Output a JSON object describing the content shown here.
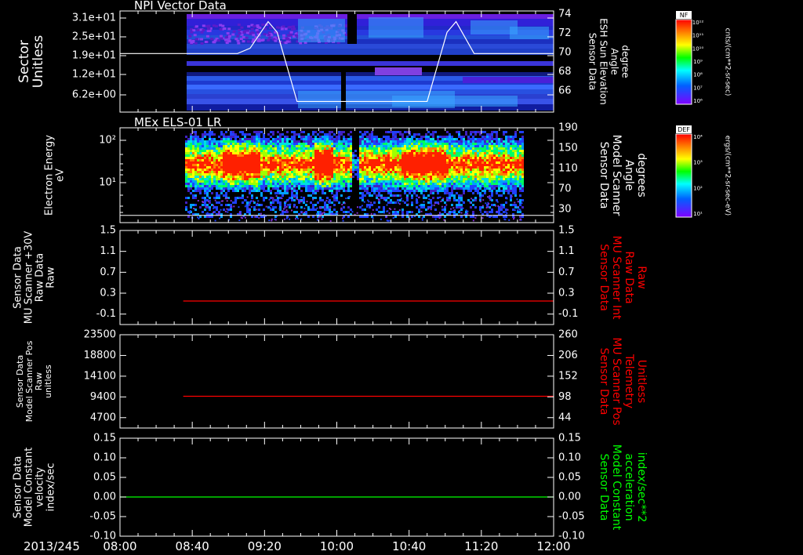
{
  "time_axis": {
    "labels": [
      "08:00",
      "08:40",
      "09:20",
      "10:00",
      "10:40",
      "11:20",
      "12:00"
    ],
    "date_label": "2013/245",
    "start": "08:00",
    "end": "12:00"
  },
  "colorbars": [
    {
      "label": "NF",
      "unit": "cnts/(cm**2-sr-sec)",
      "ticks": [
        "10¹²",
        "10¹¹",
        "10¹⁰",
        "10⁹",
        "10⁸",
        "10⁷",
        "10⁶"
      ]
    },
    {
      "label": "DEF",
      "unit": "ergs/(cm**2-sr-sec-eV)",
      "ticks": [
        "10⁴",
        "10³",
        "10²",
        "10¹"
      ]
    }
  ],
  "chart_data": [
    {
      "type": "heatmap",
      "title": "NPI Vector Data",
      "ylabel": [
        "Sector",
        "Unitless"
      ],
      "yticks": [
        "3.1e+01",
        "2.5e+01",
        "1.9e+01",
        "1.2e+01",
        "6.2e+00"
      ],
      "right_label": [
        "Sensor Data",
        "ESH Sun Elevation",
        "Angle",
        "degree"
      ],
      "right_label_color": "#ffffff",
      "right_ticks": [
        74,
        72,
        70,
        68,
        66
      ],
      "right_range": [
        64.5,
        74
      ],
      "line": {
        "color": "#ffffff",
        "x": [
          "08:00",
          "09:05",
          "09:12",
          "09:22",
          "09:27",
          "09:38",
          "10:50",
          "11:01",
          "11:06",
          "11:16",
          "12:00"
        ],
        "y": [
          70,
          70,
          70.5,
          73,
          72,
          65.5,
          65.5,
          72,
          73,
          70,
          70
        ]
      }
    },
    {
      "type": "heatmap",
      "title": "MEx ELS-01 LR",
      "ylabel": [
        "Electron Energy",
        "eV"
      ],
      "yticks": [
        "10²",
        "10¹"
      ],
      "right_label": [
        "Sensor Data",
        "Model Scanner",
        "Angle",
        "degrees"
      ],
      "right_label_color": "#ffffff",
      "right_ticks": [
        190,
        150,
        110,
        70,
        30
      ],
      "right_range": [
        0,
        190
      ],
      "line": {
        "color": "#ffffff",
        "x": [
          "08:00",
          "12:00"
        ],
        "y": [
          2,
          2
        ]
      }
    },
    {
      "type": "line",
      "ylabel": [
        "Sensor Data",
        "MU Scanner +30V",
        "Raw Data",
        "Raw"
      ],
      "yticks": [
        "1.5",
        "1.1",
        "0.7",
        "0.3",
        "-0.1"
      ],
      "yrange": [
        -0.5,
        1.5
      ],
      "right_label": [
        "Sensor Data",
        "MU Scanner Int",
        "Raw Data",
        "Raw"
      ],
      "right_label_color": "#ff0000",
      "right_ticks": [
        "1.5",
        "1.1",
        "0.7",
        "0.3",
        "-0.1"
      ],
      "series": [
        {
          "color": "#ff0000",
          "x": [
            "08:35",
            "12:00"
          ],
          "y": [
            0.0,
            0.0
          ]
        }
      ]
    },
    {
      "type": "line",
      "ylabel": [
        "Sensor Data",
        "Model Scanner Pos",
        "Raw",
        "unitless"
      ],
      "yticks": [
        "23500",
        "18800",
        "14100",
        "9400",
        "4700"
      ],
      "yrange": [
        0,
        23500
      ],
      "right_label": [
        "Sensor Data",
        "MU Scanner Pos",
        "Telemetry",
        "Unitless"
      ],
      "right_label_color": "#ff0000",
      "right_ticks": [
        "260",
        "206",
        "152",
        "98",
        "44"
      ],
      "series": [
        {
          "color": "#ff0000",
          "x": [
            "08:35",
            "12:00"
          ],
          "y": [
            8000,
            8000
          ]
        }
      ]
    },
    {
      "type": "line",
      "ylabel": [
        "Sensor Data",
        "Model Constant",
        "velocity",
        "index/sec"
      ],
      "yticks": [
        "0.15",
        "0.10",
        "0.05",
        "0.00",
        "-0.05",
        "-0.10"
      ],
      "yrange": [
        -0.1,
        0.15
      ],
      "right_label": [
        "Sensor Data",
        "Model Constant",
        "acceleration",
        "index/sec**2"
      ],
      "right_label_color": "#00ff00",
      "right_ticks": [
        "0.15",
        "0.10",
        "0.05",
        "0.00",
        "-0.05",
        "-0.10"
      ],
      "series": [
        {
          "color": "#00ff00",
          "x": [
            "08:00",
            "12:00"
          ],
          "y": [
            0.0,
            0.0
          ]
        }
      ]
    }
  ]
}
